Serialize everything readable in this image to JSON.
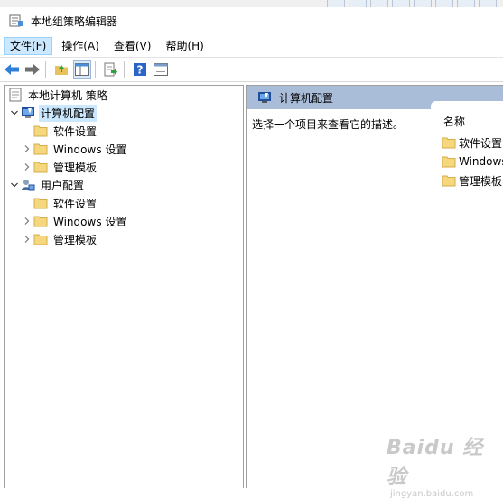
{
  "window": {
    "title": "本地组策略编辑器"
  },
  "menu": [
    {
      "label": "文件(F)"
    },
    {
      "label": "操作(A)"
    },
    {
      "label": "查看(V)"
    },
    {
      "label": "帮助(H)"
    }
  ],
  "tree": {
    "root": "本地计算机 策略",
    "computer_config": "计算机配置",
    "computer_children": [
      "软件设置",
      "Windows 设置",
      "管理模板"
    ],
    "user_config": "用户配置",
    "user_children": [
      "软件设置",
      "Windows 设置",
      "管理模板"
    ]
  },
  "right": {
    "header": "计算机配置",
    "description": "选择一个项目来查看它的描述。",
    "column_name": "名称",
    "items": [
      "软件设置",
      "Windows",
      "管理模板"
    ]
  },
  "watermark": {
    "main": "Baidu 经验",
    "sub": "jingyan.baidu.com"
  },
  "colors": {
    "folder": "#f5d77e",
    "selection": "#cce8ff",
    "right_header": "#a9bcd8",
    "back_arrow": "#2f7ed8"
  }
}
